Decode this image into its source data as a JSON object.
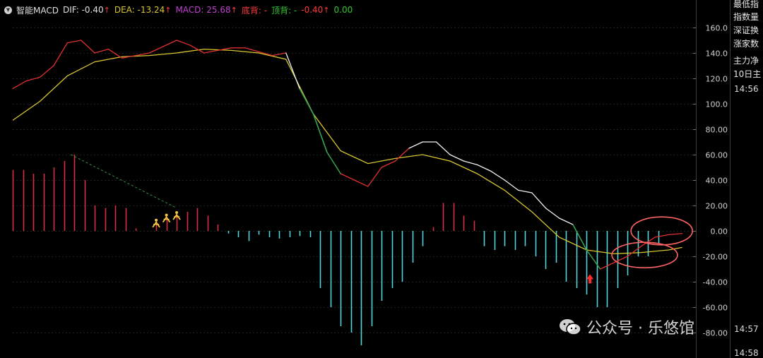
{
  "header": {
    "toggle_icon": "chevron-down-icon",
    "title": "智能MACD",
    "dif_label": "DIF: -0.40",
    "dea_label": "DEA: -13.24",
    "macd_label": "MACD: 25.68",
    "bottom_div_label": "底背: -",
    "top_div_label": "顶背: -",
    "top_div_value": "-0.40",
    "extra_value": "0.00",
    "up_arrow": "↑",
    "colors": {
      "title": "#e0e0e0",
      "dif": "#e0e0e0",
      "dea": "#d8c630",
      "macd": "#c040d0",
      "bottom_div": "#ff3b3b",
      "top_div": "#32c832",
      "top_div_value": "#ff3b3b",
      "extra": "#32c832",
      "arrow": "#ff3b3b"
    }
  },
  "right_panel": {
    "items": [
      "最低指",
      "指数量",
      "深证换",
      "涨家数",
      "主力净",
      "10日主"
    ],
    "times": [
      "14:56",
      "14:57",
      "14:58"
    ]
  },
  "watermark": {
    "icon": "wechat-icon",
    "text": "公众号 · 乐悠馆"
  },
  "chart_data": {
    "type": "line",
    "title": "",
    "xlabel": "",
    "ylabel": "",
    "ylim": [
      -90,
      175
    ],
    "y_ticks": [
      "160.0",
      "140.0",
      "120.0",
      "100.0",
      "80.00",
      "60.00",
      "40.00",
      "20.00",
      "0.00",
      "-20.00",
      "-40.00",
      "-60.00",
      "-80.00"
    ],
    "y_tick_values": [
      160,
      140,
      120,
      100,
      80,
      60,
      40,
      20,
      0,
      -20,
      -40,
      -60,
      -80
    ],
    "x_range": [
      0,
      100
    ],
    "grid": true,
    "series": [
      {
        "key": "dif",
        "values_x": [
          0,
          2,
          4,
          6,
          8,
          10,
          12,
          14,
          16,
          18,
          20,
          22,
          24,
          26,
          28,
          30,
          32,
          34,
          36,
          38,
          40,
          42,
          44,
          46,
          48,
          50,
          52,
          54,
          56,
          58,
          60,
          62,
          64,
          66,
          68,
          70,
          72,
          74,
          76,
          78,
          80,
          82,
          84,
          86,
          88,
          90,
          92,
          94,
          96,
          98
        ],
        "values_y": [
          112,
          118,
          121,
          130,
          148,
          150,
          140,
          143,
          136,
          138,
          140,
          145,
          150,
          146,
          140,
          142,
          144,
          144,
          141,
          138,
          140,
          112,
          92,
          62,
          45,
          40,
          35,
          50,
          55,
          65,
          70,
          70,
          60,
          55,
          52,
          47,
          40,
          32,
          30,
          18,
          10,
          5,
          -15,
          -30,
          -25,
          -20,
          -12,
          -5,
          -3,
          -2
        ],
        "color_segments": [
          {
            "from": 0,
            "to": 9,
            "color": "#e03030"
          },
          {
            "from": 9,
            "to": 11,
            "color": "#f0f0f0"
          },
          {
            "from": 11,
            "to": 40,
            "color": "#e03030"
          },
          {
            "from": 40,
            "to": 46,
            "color": "#f0f0f0"
          },
          {
            "from": 46,
            "to": 58,
            "color": "#e03030"
          },
          {
            "from": 58,
            "to": 84,
            "color": "#f0f0f0"
          },
          {
            "from": 84,
            "to": 98,
            "color": "#e03030"
          }
        ]
      },
      {
        "key": "dea",
        "values_x": [
          0,
          4,
          8,
          12,
          16,
          20,
          24,
          28,
          32,
          36,
          40,
          44,
          48,
          52,
          56,
          60,
          64,
          68,
          72,
          76,
          80,
          84,
          88,
          92,
          96,
          98
        ],
        "values_y": [
          87,
          102,
          122,
          133,
          137,
          138,
          140,
          143,
          142,
          140,
          135,
          92,
          63,
          53,
          57,
          60,
          55,
          45,
          32,
          15,
          -5,
          -15,
          -18,
          -17,
          -15,
          -13
        ]
      }
    ],
    "histogram": {
      "x": [
        0,
        1.5,
        3,
        4.5,
        6,
        7.5,
        9,
        10.5,
        12,
        13.5,
        15,
        16.5,
        18,
        19.5,
        21,
        22.5,
        24,
        25.5,
        27,
        28.5,
        30,
        31.5,
        33,
        34.5,
        36,
        37.5,
        39,
        40.5,
        42,
        43.5,
        45,
        46.5,
        48,
        49.5,
        51,
        52.5,
        54,
        55.5,
        57,
        58.5,
        60,
        61.5,
        63,
        64.5,
        66,
        67.5,
        69,
        70.5,
        72,
        73.5,
        75,
        76.5,
        78,
        79.5,
        81,
        82.5,
        84,
        85.5,
        87,
        88.5,
        90,
        91.5,
        93,
        94.5
      ],
      "values": [
        48,
        48,
        45,
        45,
        50,
        55,
        60,
        40,
        20,
        18,
        20,
        18,
        2,
        0,
        8,
        10,
        12,
        15,
        18,
        12,
        5,
        -2,
        -5,
        -8,
        -3,
        -5,
        -6,
        -5,
        -4,
        -5,
        -45,
        -60,
        -75,
        -80,
        -90,
        -75,
        -55,
        -45,
        -40,
        -25,
        -12,
        3,
        22,
        22,
        12,
        8,
        -12,
        -15,
        -12,
        -15,
        -12,
        -20,
        -30,
        -25,
        -40,
        -45,
        -50,
        -60,
        -60,
        -45,
        -35,
        -20,
        -20,
        -10,
        -5,
        -5,
        -3
      ],
      "up_color": "#d83040",
      "down_color": "#58d4dc"
    },
    "annotations": {
      "divergence_line": {
        "x1": 8.5,
        "y1": 60,
        "x2": 24,
        "y2": 18,
        "color": "#2e9a4a"
      },
      "buy_markers_x": [
        21,
        22.5,
        24
      ],
      "buy_markers_y": [
        4,
        8,
        10
      ],
      "buy_marker_color": "#f5c842",
      "signal_arrow": {
        "x": 84.5,
        "y": -38,
        "color": "#ff2a2a"
      },
      "circles": [
        {
          "cx": 95,
          "cy": 0,
          "rx": 4.5,
          "ry": 11,
          "color": "#ff6464"
        },
        {
          "cx": 92.5,
          "cy": -19,
          "rx": 4.8,
          "ry": 10,
          "color": "#ff6464"
        }
      ]
    }
  }
}
